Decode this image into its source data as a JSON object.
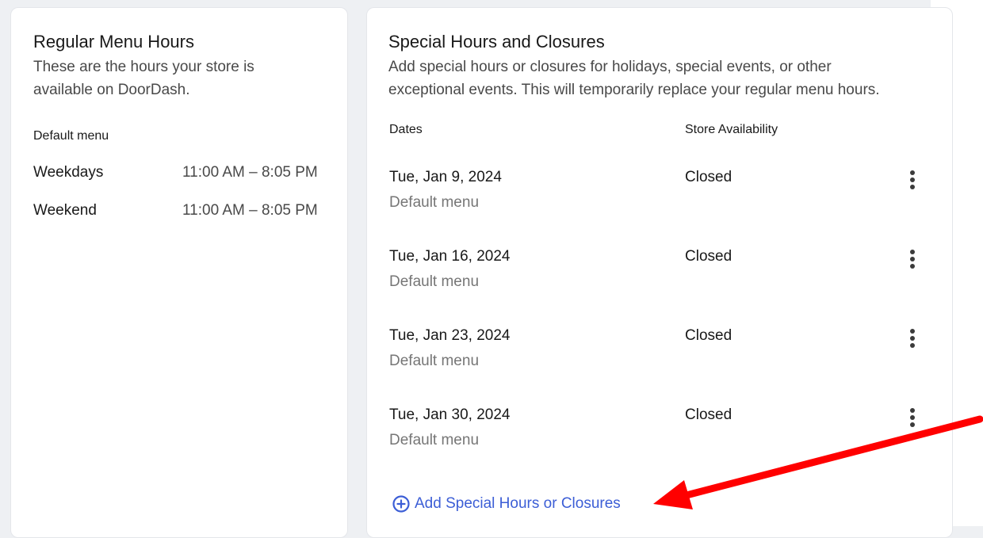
{
  "regular": {
    "title": "Regular Menu Hours",
    "description_line1": "These are the hours your store is",
    "description_line2": "available on DoorDash.",
    "menu_label": "Default menu",
    "rows": [
      {
        "day": "Weekdays",
        "hours": "11:00 AM – 8:05 PM"
      },
      {
        "day": "Weekend",
        "hours": "11:00 AM – 8:05 PM"
      }
    ]
  },
  "special": {
    "title": "Special Hours and Closures",
    "description_line1": "Add special hours or closures for holidays, special events, or other",
    "description_line2": "exceptional events. This will temporarily replace your regular menu hours.",
    "col_dates": "Dates",
    "col_availability": "Store Availability",
    "rows": [
      {
        "date": "Tue, Jan 9, 2024",
        "menu": "Default menu",
        "status": "Closed"
      },
      {
        "date": "Tue, Jan 16, 2024",
        "menu": "Default menu",
        "status": "Closed"
      },
      {
        "date": "Tue, Jan 23, 2024",
        "menu": "Default menu",
        "status": "Closed"
      },
      {
        "date": "Tue, Jan 30, 2024",
        "menu": "Default menu",
        "status": "Closed"
      }
    ],
    "add_label": "Add Special Hours or Closures",
    "add_icon": "plus-circle-icon",
    "row_menu_icon": "more-vertical-icon"
  },
  "annotation": {
    "arrow_color": "#ff0000",
    "arrow_icon": "red-arrow-annotation"
  },
  "colors": {
    "link": "#3c5ed6",
    "text": "#191919",
    "muted": "#767676"
  }
}
